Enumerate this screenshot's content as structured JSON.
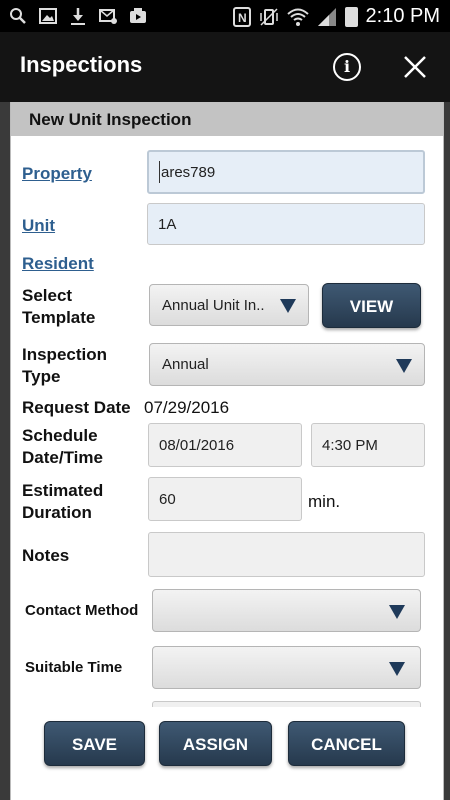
{
  "status_bar": {
    "time": "2:10 PM",
    "left_icons": [
      "search-icon",
      "image-icon",
      "download-icon",
      "mail-icon",
      "photo-icon"
    ],
    "right_icons": [
      "nfc-icon",
      "vibrate-icon",
      "wifi-icon",
      "signal-icon",
      "battery-icon"
    ]
  },
  "app_bar": {
    "title": "Inspections",
    "info_icon": "info-icon",
    "close_icon": "close-icon",
    "info_glyph": "i"
  },
  "form": {
    "header": "New Unit Inspection",
    "property": {
      "label": "Property",
      "value": "ares789"
    },
    "unit": {
      "label": "Unit",
      "value": "1A"
    },
    "resident": {
      "label": "Resident"
    },
    "select_template": {
      "label_line1": "Select",
      "label_line2": "Template",
      "value": "Annual Unit In..",
      "view_button": "VIEW"
    },
    "inspection_type": {
      "label_line1": "Inspection",
      "label_line2": "Type",
      "value": "Annual"
    },
    "request_date": {
      "label": "Request Date",
      "value": "07/29/2016"
    },
    "schedule": {
      "label_line1": "Schedule",
      "label_line2": "Date/Time",
      "date": "08/01/2016",
      "time": "4:30 PM"
    },
    "duration": {
      "label_line1": "Estimated",
      "label_line2": "Duration",
      "value": "60",
      "unit": "min."
    },
    "notes": {
      "label": "Notes",
      "value": ""
    },
    "contact_method": {
      "label": "Contact Method",
      "value": ""
    },
    "suitable_time": {
      "label": "Suitable Time",
      "value": ""
    }
  },
  "actions": {
    "save": "SAVE",
    "assign": "ASSIGN",
    "cancel": "CANCEL"
  },
  "colors": {
    "button_bg": "#2f4560",
    "link": "#2e5f8f",
    "header_bg": "#c3c3c3",
    "app_bar_bg": "#141414"
  }
}
